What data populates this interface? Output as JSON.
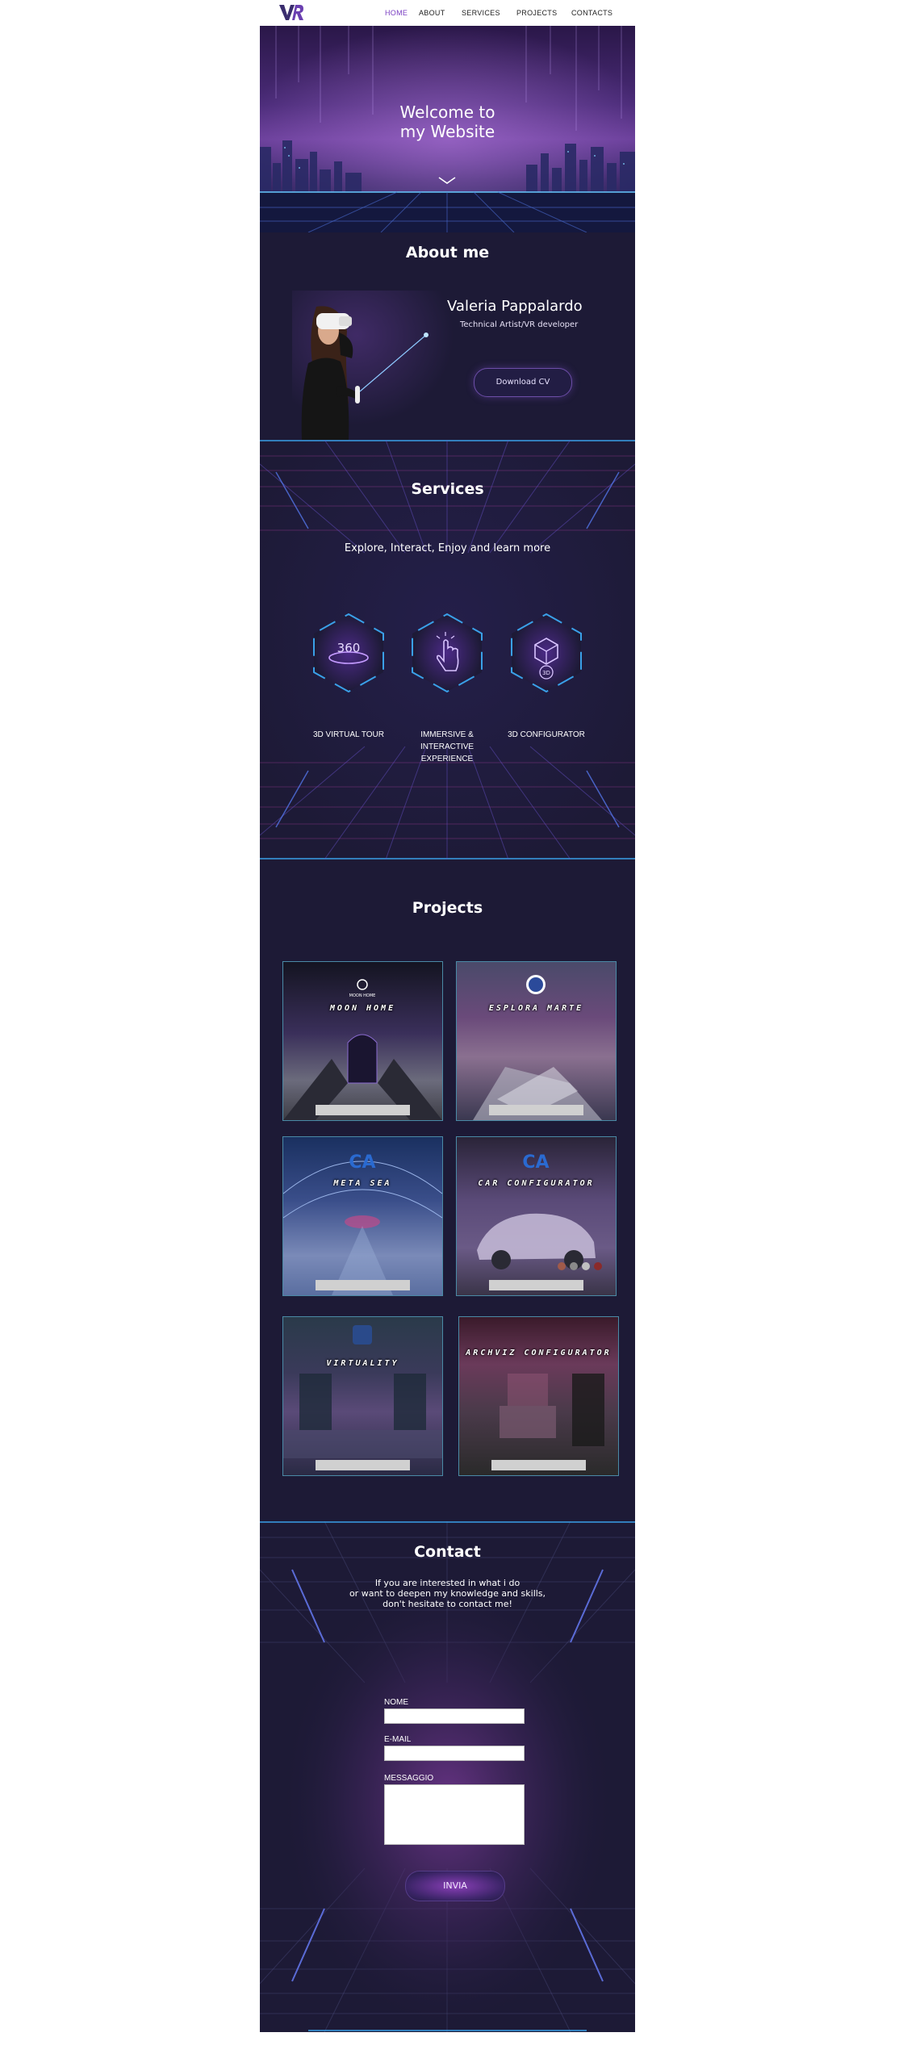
{
  "header": {
    "logo_text": "VR",
    "nav": [
      "HOME",
      "ABOUT",
      "SERVICES",
      "PROJECTS",
      "CONTACTS"
    ],
    "active": "HOME"
  },
  "hero": {
    "title_line1": "Welcome to",
    "title_line2": "my Website",
    "scroll_icon": "chevron-down-icon"
  },
  "about": {
    "title": "About me",
    "name": "Valeria Pappalardo",
    "role": "Technical Artist/VR developer",
    "cv_button": "Download CV"
  },
  "services": {
    "title": "Services",
    "subtitle": "Explore, Interact, Enjoy and learn more",
    "items": [
      {
        "label": "3D VIRTUAL TOUR",
        "icon": "360-icon",
        "icon_text": "360"
      },
      {
        "label": "IMMERSIVE & INTERACTIVE EXPERIENCE",
        "icon": "touch-hand-icon"
      },
      {
        "label": "3D CONFIGURATOR",
        "icon": "cube-3d-icon",
        "icon_text": "3D"
      }
    ]
  },
  "projects": {
    "title": "Projects",
    "items": [
      {
        "title": "MOON HOME",
        "logo_text": "MOON HOME"
      },
      {
        "title": "ESPLORA MARTE"
      },
      {
        "title": "META SEA"
      },
      {
        "title": "CAR CONFIGURATOR"
      },
      {
        "title": "VIRTUALITY"
      },
      {
        "title": "ARCHVIZ CONFIGURATOR"
      }
    ]
  },
  "contact": {
    "title": "Contact",
    "text_line1": "If you are interested in what i do",
    "text_line2": "or want to deepen my knowledge and skills,",
    "text_line3": "don't hesitate to contact me!",
    "fields": {
      "name_label": "NOME",
      "email_label": "E-MAIL",
      "message_label": "MESSAGGIO",
      "name_value": "",
      "email_value": "",
      "message_value": ""
    },
    "send_button": "INVIA"
  },
  "colors": {
    "background": "#1d1a36",
    "accent": "#7a3fc2",
    "neon_blue": "#3aa0e8",
    "neon_pink": "#b03fa0"
  }
}
